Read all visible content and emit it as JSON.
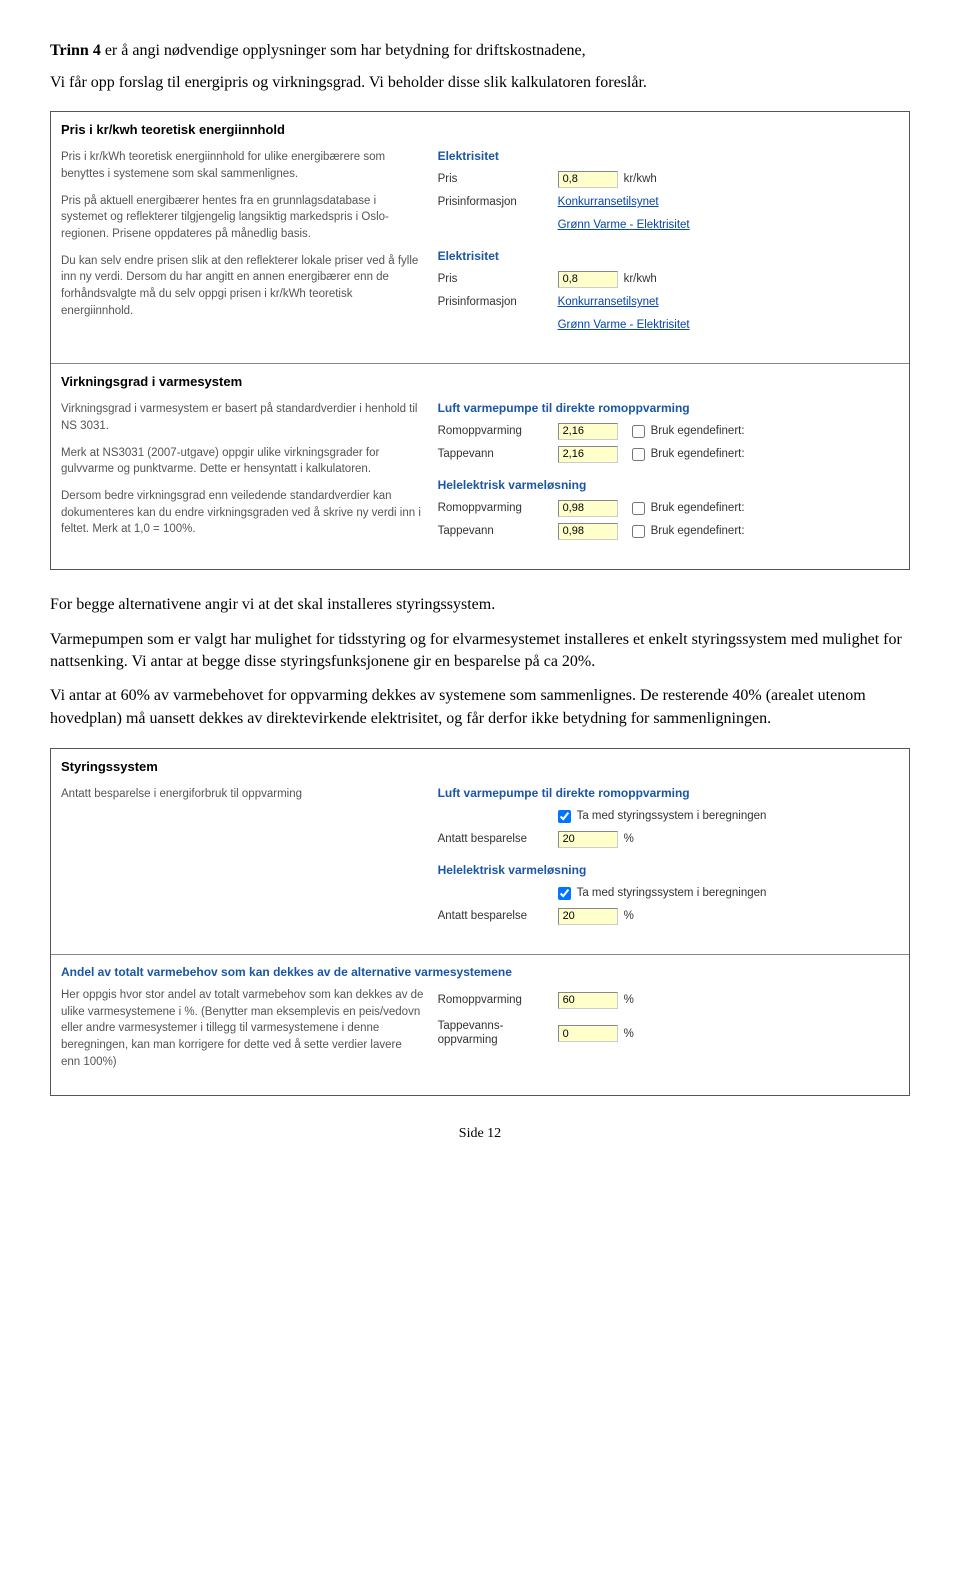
{
  "intro": {
    "p1a": "Trinn 4",
    "p1b": " er å angi nødvendige opplysninger som har betydning for driftskostnadene,",
    "p2": "Vi får opp forslag til energipris og virkningsgrad. Vi beholder disse slik kalkulatoren foreslår."
  },
  "panel1": {
    "secA": {
      "title": "Pris i kr/kwh teoretisk energiinnhold",
      "left": {
        "p1": "Pris i kr/kWh teoretisk energiinnhold for ulike energibærere som benyttes i systemene som skal sammenlignes.",
        "p2": "Pris på aktuell energibærer hentes fra en grunnlagsdatabase i systemet og reflekterer tilgjengelig langsiktig markedspris i Oslo-regionen. Prisene oppdateres på månedlig basis.",
        "p3": "Du kan selv endre prisen slik at den reflekterer lokale priser ved å fylle inn ny verdi. Dersom du har angitt en annen energibærer enn de forhåndsvalgte må du selv oppgi prisen i kr/kWh teoretisk energiinnhold."
      },
      "blocks": [
        {
          "title": "Elektrisitet",
          "rows": {
            "price_label": "Pris",
            "price_value": "0,8",
            "price_unit": "kr/kwh",
            "info_label": "Prisinformasjon",
            "info_link": "Konkurransetilsynet",
            "info_link2": "Grønn Varme - Elektrisitet"
          }
        },
        {
          "title": "Elektrisitet",
          "rows": {
            "price_label": "Pris",
            "price_value": "0,8",
            "price_unit": "kr/kwh",
            "info_label": "Prisinformasjon",
            "info_link": "Konkurransetilsynet",
            "info_link2": "Grønn Varme - Elektrisitet"
          }
        }
      ]
    },
    "secB": {
      "title": "Virkningsgrad i varmesystem",
      "left": {
        "p1": "Virkningsgrad i varmesystem er basert på standardverdier i henhold til NS 3031.",
        "p2": "Merk at NS3031 (2007-utgave) oppgir ulike virkningsgrader for gulvvarme og punktvarme. Dette er hensyntatt i kalkulatoren.",
        "p3": "Dersom bedre virkningsgrad enn veiledende standardverdier kan dokumenteres kan du endre virkningsgraden ved å skrive ny verdi inn i feltet. Merk at 1,0 = 100%."
      },
      "blocks": [
        {
          "title": "Luft varmepumpe til direkte romoppvarming",
          "rows": [
            {
              "label": "Romoppvarming",
              "value": "2,16",
              "cb_label": "Bruk egendefinert:"
            },
            {
              "label": "Tappevann",
              "value": "2,16",
              "cb_label": "Bruk egendefinert:"
            }
          ]
        },
        {
          "title": "Helelektrisk varmeløsning",
          "rows": [
            {
              "label": "Romoppvarming",
              "value": "0,98",
              "cb_label": "Bruk egendefinert:"
            },
            {
              "label": "Tappevann",
              "value": "0,98",
              "cb_label": "Bruk egendefinert:"
            }
          ]
        }
      ]
    }
  },
  "mid": {
    "p1": "For begge alternativene angir vi at det skal installeres styringssystem.",
    "p2": "Varmepumpen som er valgt har mulighet for tidsstyring og for elvarmesystemet installeres et enkelt styringssystem med mulighet for nattsenking. Vi antar at begge disse styringsfunksjonene gir en besparelse på ca 20%.",
    "p3": "Vi antar at 60% av varmebehovet for oppvarming dekkes av systemene som sammenlignes. De resterende 40% (arealet utenom hovedplan) må uansett dekkes av direktevirkende elektrisitet, og får derfor ikke betydning for sammenligningen."
  },
  "panel2": {
    "secA": {
      "title": "Styringssystem",
      "left": {
        "p1": "Antatt besparelse i energiforbruk til oppvarming"
      },
      "blocks": [
        {
          "title": "Luft varmepumpe til direkte romoppvarming",
          "cb_label": "Ta med styringssystem i beregningen",
          "row": {
            "label": "Antatt besparelse",
            "value": "20",
            "unit": "%"
          }
        },
        {
          "title": "Helelektrisk varmeløsning",
          "cb_label": "Ta med styringssystem i beregningen",
          "row": {
            "label": "Antatt besparelse",
            "value": "20",
            "unit": "%"
          }
        }
      ]
    },
    "secB": {
      "title": "Andel av totalt varmebehov som kan dekkes av de alternative varmesystemene",
      "left": {
        "p1": "Her oppgis hvor stor andel av totalt varmebehov som kan dekkes av de ulike varmesystemene i %. (Benytter man eksemplevis en peis/vedovn eller andre varmesystemer i tillegg til varmesystemene i denne beregningen, kan man korrigere for dette ved å sette verdier lavere enn 100%)"
      },
      "rows": [
        {
          "label": "Romoppvarming",
          "value": "60",
          "unit": "%"
        },
        {
          "label": "Tappevanns-oppvarming",
          "value": "0",
          "unit": "%"
        }
      ]
    }
  },
  "footer": "Side 12"
}
